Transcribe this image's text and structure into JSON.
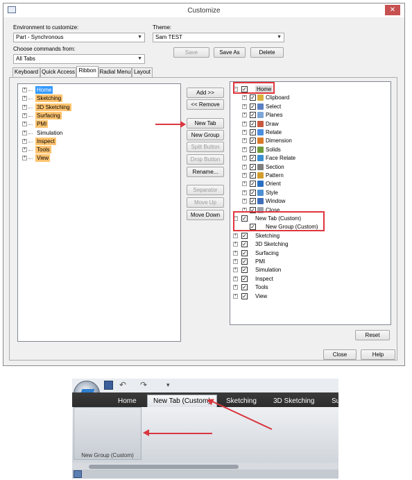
{
  "dialog": {
    "title": "Customize",
    "close_glyph": "✕",
    "env_label": "Environment to customize:",
    "env_value": "Part - Synchronous",
    "theme_label": "Theme:",
    "theme_value": "Sam TEST",
    "choose_label": "Choose commands from:",
    "choose_value": "All Tabs",
    "save_label": "Save",
    "saveas_label": "Save As",
    "delete_label": "Delete",
    "tabs": [
      "Keyboard",
      "Quick Access",
      "Ribbon",
      "Radial Menu",
      "Layout"
    ],
    "active_tab": "Ribbon",
    "left_items": [
      {
        "label": "Home",
        "style": "selected"
      },
      {
        "label": "Sketching",
        "style": "highlight"
      },
      {
        "label": "3D Sketching",
        "style": "highlight"
      },
      {
        "label": "Surfacing",
        "style": "highlight"
      },
      {
        "label": "PMI",
        "style": "highlight"
      },
      {
        "label": "Simulation",
        "style": "plain"
      },
      {
        "label": "Inspect",
        "style": "highlight"
      },
      {
        "label": "Tools",
        "style": "highlight"
      },
      {
        "label": "View",
        "style": "highlight"
      }
    ],
    "middle_buttons": {
      "add": "Add >>",
      "remove": "<< Remove",
      "new_tab": "New Tab",
      "new_group": "New Group",
      "split_button": "Split Button",
      "drop_button": "Drop Button",
      "rename": "Rename...",
      "separator": "Separator",
      "move_up": "Move Up",
      "move_down": "Move Down"
    },
    "home_label": "Home",
    "home_groups": [
      "Clipboard",
      "Select",
      "Planes",
      "Draw",
      "Relate",
      "Dimension",
      "Solids",
      "Face Relate",
      "Section",
      "Pattern",
      "Orient",
      "Style",
      "Window",
      "Close"
    ],
    "new_tab_label": "New Tab (Custom)",
    "new_group_label": "New Group (Custom)",
    "right_tabs": [
      "Sketching",
      "3D Sketching",
      "Surfacing",
      "PMI",
      "Simulation",
      "Inspect",
      "Tools",
      "View"
    ],
    "reset_label": "Reset",
    "close_label": "Close",
    "help_label": "Help"
  },
  "ribbon": {
    "tabs": [
      "Home",
      "New Tab (Custom)",
      "Sketching",
      "3D Sketching",
      "Su"
    ],
    "active_tab": "New Tab (Custom)",
    "group_label": "New Group (Custom)",
    "qat_arrow": "▾"
  },
  "colors": {
    "highlight": "#ffc470",
    "selection": "#3399ff",
    "annotation_red": "#e0353d",
    "close_button": "#c75050"
  }
}
